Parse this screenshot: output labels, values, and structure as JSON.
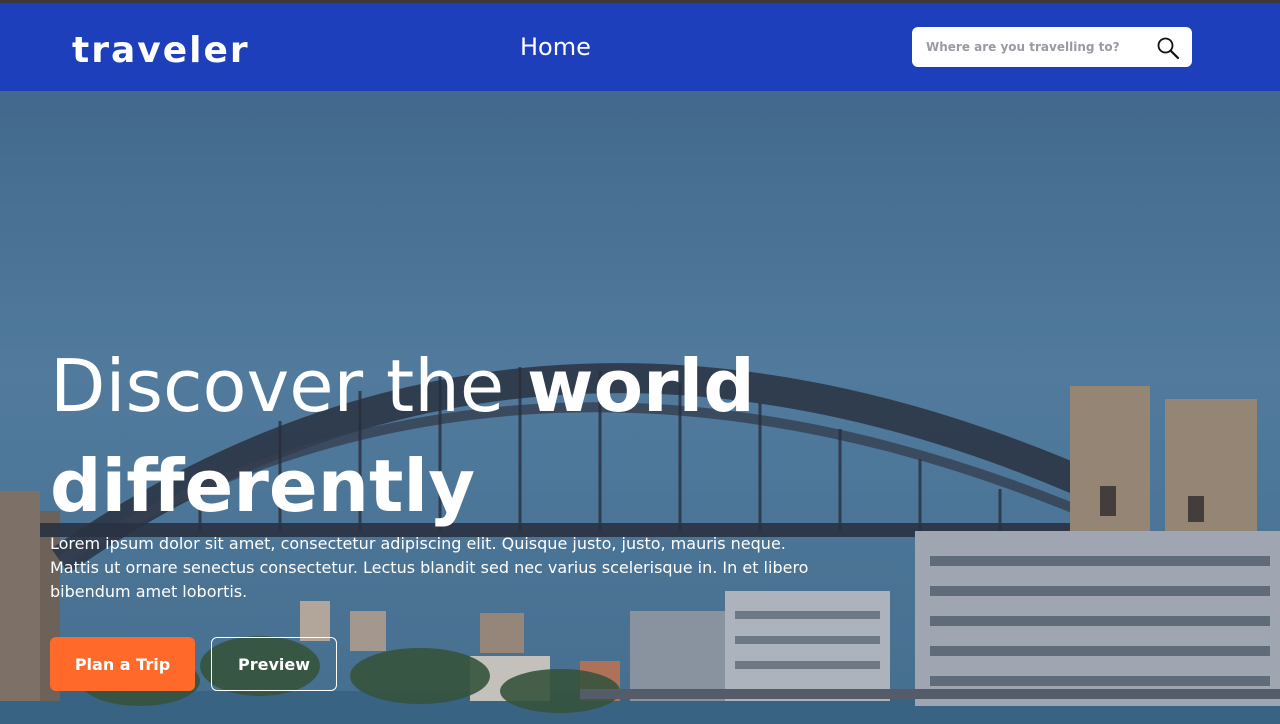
{
  "header": {
    "logo_text": "traveler",
    "nav": {
      "home_label": "Home"
    },
    "search": {
      "placeholder": "Where are you travelling to?",
      "icon": "search-icon"
    }
  },
  "hero": {
    "headline_light": "Discover the ",
    "headline_bold": "world",
    "headline_line2": "differently",
    "description": "Lorem ipsum dolor sit amet, consectetur adipiscing elit. Quisque justo, justo, mauris neque. Mattis ut ornare senectus consectetur. Lectus blandit sed nec varius scelerisque in. In et libero bibendum amet lobortis.",
    "primary_button": "Plan a Trip",
    "secondary_button": "Preview"
  },
  "colors": {
    "nav_background": "#1d3fbb",
    "primary_button": "#ff6a2b",
    "text_light": "#ffffff"
  }
}
